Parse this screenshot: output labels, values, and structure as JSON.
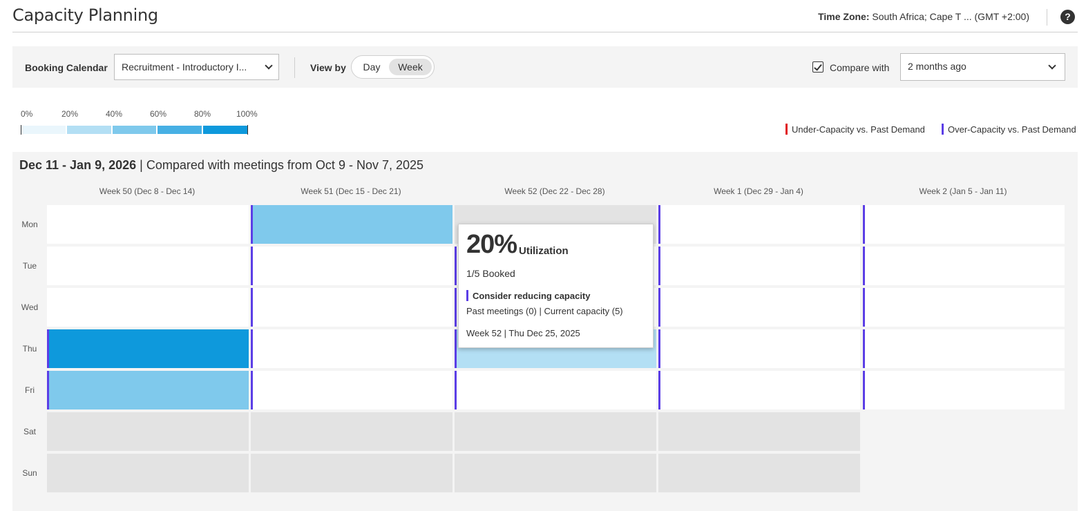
{
  "header": {
    "title": "Capacity Planning",
    "timezone_label": "Time Zone:",
    "timezone_value": "South Africa; Cape T ... (GMT +2:00)",
    "help_icon": "question-circle-icon",
    "help_glyph": "?"
  },
  "toolbar": {
    "booking_calendar_label": "Booking Calendar",
    "booking_calendar_value": "Recruitment - Introductory I...",
    "view_by_label": "View by",
    "view_options": [
      "Day",
      "Week"
    ],
    "view_selected": "Week",
    "compare_checked": true,
    "compare_label": "Compare with",
    "compare_value": "2 months ago"
  },
  "scale": {
    "ticks": [
      "0%",
      "20%",
      "40%",
      "60%",
      "80%",
      "100%"
    ],
    "colors": [
      "#eaf6fc",
      "#b3dff4",
      "#7fc9ec",
      "#47b0e4",
      "#0e99dc"
    ]
  },
  "legend": {
    "under": {
      "label": "Under-Capacity vs. Past Demand",
      "color": "#e0181e"
    },
    "over": {
      "label": "Over-Capacity vs. Past Demand",
      "color": "#5b3ee6"
    }
  },
  "panel": {
    "range": "Dec 11 - Jan 9, 2026",
    "compared": "Compared with meetings from Oct 9 - Nov 7, 2025",
    "weeks": [
      "Week 50 (Dec 8 - Dec 14)",
      "Week 51 (Dec 15 - Dec 21)",
      "Week 52 (Dec 22 - Dec 28)",
      "Week 1 (Dec 29 - Jan 4)",
      "Week 2 (Jan 5 - Jan 11)"
    ],
    "days": [
      "Mon",
      "Tue",
      "Wed",
      "Thu",
      "Fri",
      "Sat",
      "Sun"
    ],
    "cells": [
      [
        {
          "state": "blank"
        },
        {
          "state": "blank"
        },
        {
          "state": "blank"
        },
        {
          "state": "util",
          "level": 1.0,
          "over": true
        },
        {
          "state": "util",
          "level": 0.4,
          "over": true
        },
        {
          "state": "off"
        },
        {
          "state": "off"
        }
      ],
      [
        {
          "state": "util",
          "level": 0.6,
          "over": true
        },
        {
          "state": "util",
          "level": 0,
          "over": true
        },
        {
          "state": "util",
          "level": 0,
          "over": true
        },
        {
          "state": "util",
          "level": 0,
          "over": true
        },
        {
          "state": "util",
          "level": 0,
          "over": true
        },
        {
          "state": "off"
        },
        {
          "state": "off"
        }
      ],
      [
        {
          "state": "off"
        },
        {
          "state": "util",
          "level": 0,
          "over": true
        },
        {
          "state": "util",
          "level": 0,
          "over": true
        },
        {
          "state": "util",
          "level": 0.2,
          "over": true
        },
        {
          "state": "util",
          "level": 0,
          "over": true
        },
        {
          "state": "off"
        },
        {
          "state": "off"
        }
      ],
      [
        {
          "state": "util",
          "level": 0,
          "over": true
        },
        {
          "state": "util",
          "level": 0,
          "over": true
        },
        {
          "state": "util",
          "level": 0,
          "over": true
        },
        {
          "state": "util",
          "level": 0,
          "over": true
        },
        {
          "state": "util",
          "level": 0,
          "over": true
        },
        {
          "state": "off"
        },
        {
          "state": "off"
        }
      ],
      [
        {
          "state": "util",
          "level": 0,
          "over": true
        },
        {
          "state": "util",
          "level": 0,
          "over": true
        },
        {
          "state": "util",
          "level": 0,
          "over": true
        },
        {
          "state": "util",
          "level": 0,
          "over": true
        },
        {
          "state": "util",
          "level": 0,
          "over": true
        },
        {
          "state": "none"
        },
        {
          "state": "none"
        }
      ]
    ]
  },
  "tooltip": {
    "percent": "20%",
    "utilization_label": "Utilization",
    "booked": "1/5 Booked",
    "recommendation": "Consider reducing capacity",
    "detail": "Past meetings (0) | Current capacity (5)",
    "date": "Week 52 | Thu Dec 25, 2025"
  }
}
